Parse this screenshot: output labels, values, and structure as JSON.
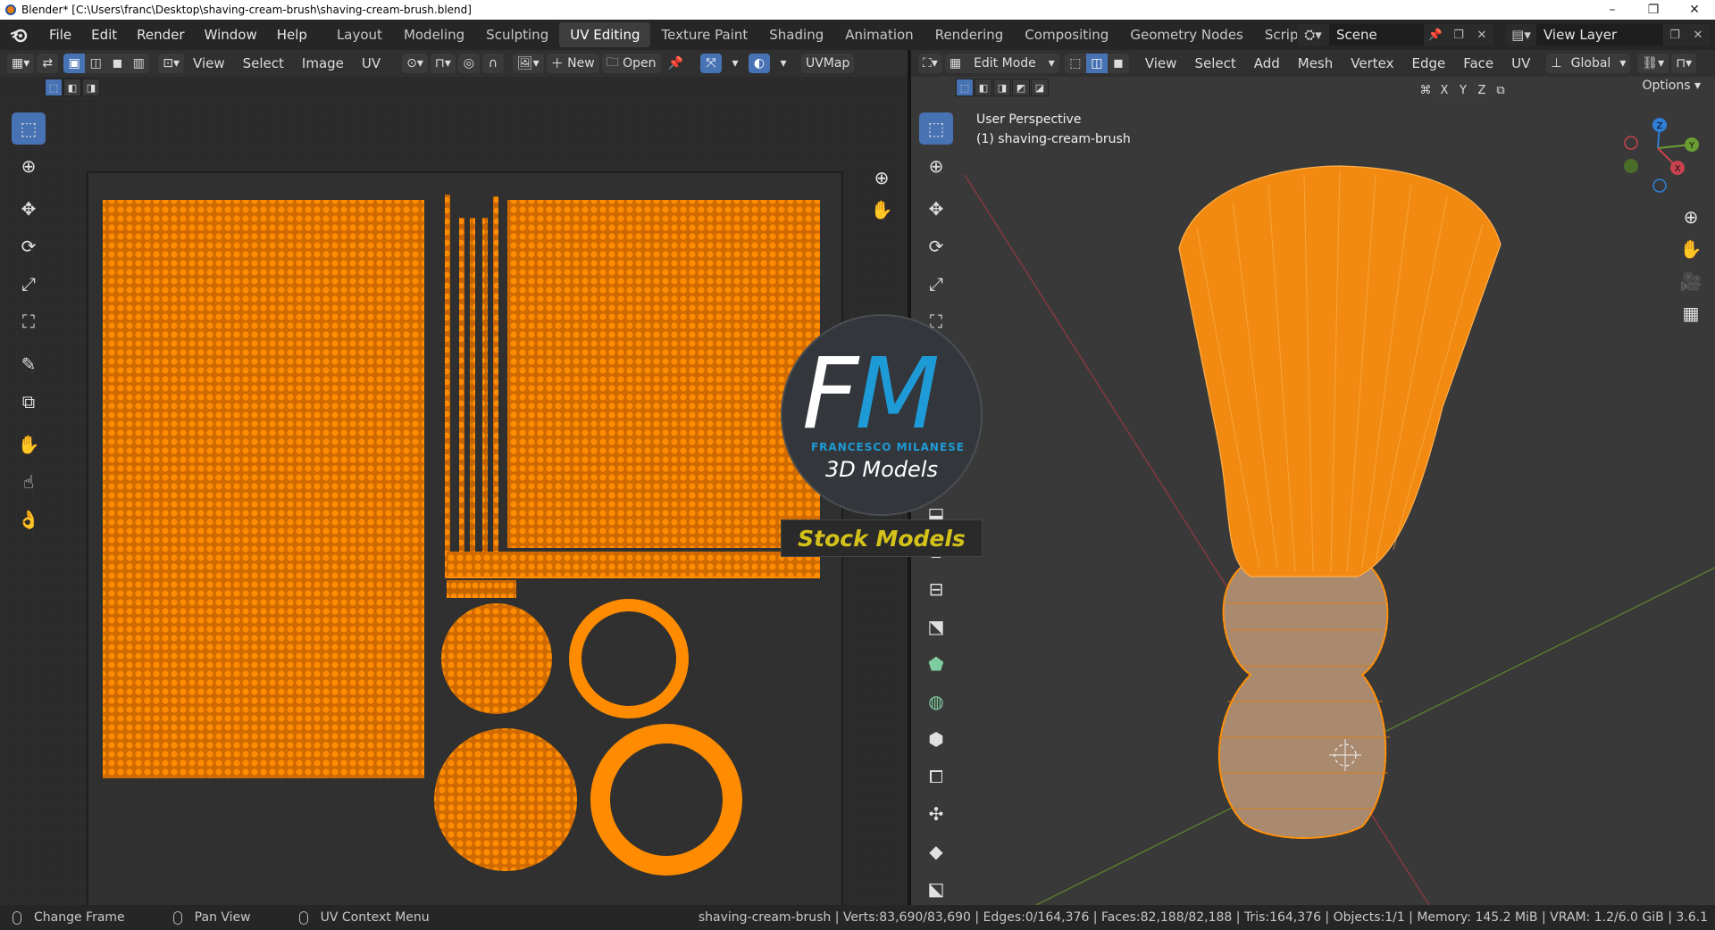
{
  "window": {
    "title": "Blender* [C:\\Users\\franc\\Desktop\\shaving-cream-brush\\shaving-cream-brush.blend]",
    "controls": [
      "–",
      "❐",
      "✕"
    ]
  },
  "topbar": {
    "menus": [
      "File",
      "Edit",
      "Render",
      "Window",
      "Help"
    ],
    "workspaces": [
      "Layout",
      "Modeling",
      "Sculpting",
      "UV Editing",
      "Texture Paint",
      "Shading",
      "Animation",
      "Rendering",
      "Compositing",
      "Geometry Nodes",
      "Scripting"
    ],
    "active_workspace": "UV Editing",
    "add_tab": "+",
    "scene": "Scene",
    "view_layer": "View Layer"
  },
  "uv_editor": {
    "header_menus": [
      "View",
      "Select",
      "Image",
      "UV"
    ],
    "new_label": "New",
    "open_label": "Open",
    "uvmap_label": "UVMap",
    "tools": [
      "select-box",
      "cursor",
      "move",
      "rotate",
      "scale",
      "transform",
      "annotate",
      "rip-region",
      "grab",
      "relax",
      "pinch"
    ]
  },
  "viewport": {
    "mode": "Edit Mode",
    "header_menus": [
      "View",
      "Select",
      "Add",
      "Mesh",
      "Vertex",
      "Edge",
      "Face",
      "UV"
    ],
    "orientation": "Global",
    "options_label": "Options",
    "axes": [
      "X",
      "Y",
      "Z"
    ],
    "view_name": "User Perspective",
    "object_label": "(1) shaving-cream-brush",
    "gizmo_axes": [
      "Z",
      "Y",
      "X"
    ]
  },
  "watermark": {
    "letter_f": "F",
    "letter_m": "M",
    "subtitle": "FRANCESCO MILANESE",
    "models": "3D Models",
    "stock": "Stock Models"
  },
  "statusbar": {
    "hints": [
      "Change Frame",
      "Pan View",
      "UV Context Menu"
    ],
    "stats": "shaving-cream-brush | Verts:83,690/83,690 | Edges:0/164,376 | Faces:82,188/82,188 | Tris:164,376 | Objects:1/1 | Memory: 145.2 MiB | VRAM: 1.2/6.0 GiB | 3.6.1"
  },
  "colors": {
    "accent": "#4772b3",
    "uv_selected": "#ff8c00",
    "x_axis": "#c8434f",
    "y_axis": "#6b9e32",
    "z_axis": "#2f7fd6"
  }
}
